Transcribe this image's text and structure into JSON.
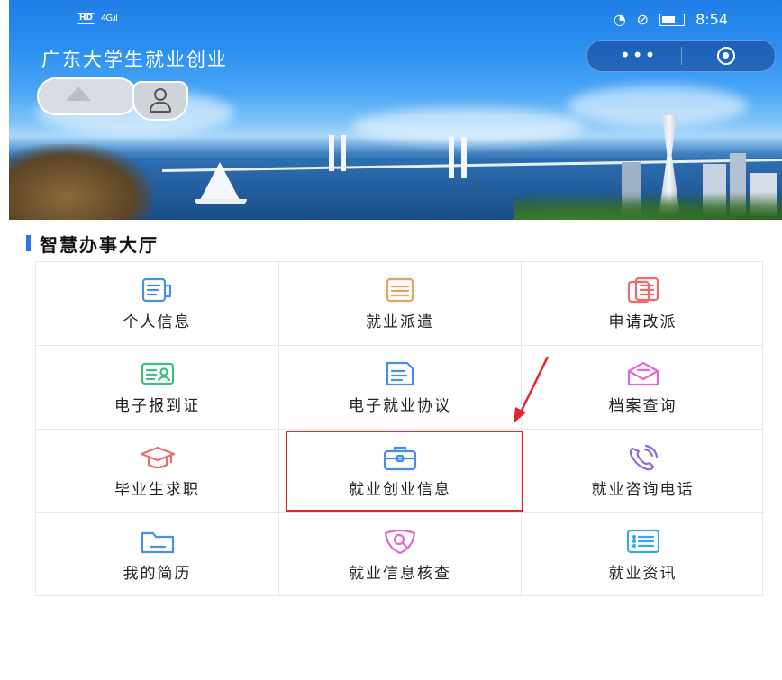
{
  "status_bar": {
    "left_badge": "HD",
    "signal": "4G.ıl",
    "time": "8:54"
  },
  "header": {
    "title": "广东大学生就业创业",
    "capsule_more": "•••"
  },
  "section": {
    "title": "智慧办事大厅"
  },
  "grid_items": [
    {
      "label": "个人信息",
      "icon": "profile-card-icon",
      "color": "#4a8fe7"
    },
    {
      "label": "就业派遣",
      "icon": "document-icon",
      "color": "#f0a05a"
    },
    {
      "label": "申请改派",
      "icon": "copy-document-icon",
      "color": "#f06a6a"
    },
    {
      "label": "电子报到证",
      "icon": "id-card-icon",
      "color": "#3fbf7f"
    },
    {
      "label": "电子就业协议",
      "icon": "agreement-icon",
      "color": "#4a8fe7"
    },
    {
      "label": "档案查询",
      "icon": "envelope-icon",
      "color": "#e06ad0"
    },
    {
      "label": "毕业生求职",
      "icon": "graduation-cap-icon",
      "color": "#f06a6a"
    },
    {
      "label": "就业创业信息",
      "icon": "briefcase-icon",
      "color": "#4a8fe7"
    },
    {
      "label": "就业咨询电话",
      "icon": "phone-icon",
      "color": "#8f6ae0"
    },
    {
      "label": "我的简历",
      "icon": "folder-icon",
      "color": "#4a8fe7"
    },
    {
      "label": "就业信息核查",
      "icon": "search-shield-icon",
      "color": "#e06ad0"
    },
    {
      "label": "就业资讯",
      "icon": "list-icon",
      "color": "#3aa8e8"
    }
  ],
  "colors": {
    "accent": "#2a76e8",
    "highlight": "#e3242b"
  }
}
